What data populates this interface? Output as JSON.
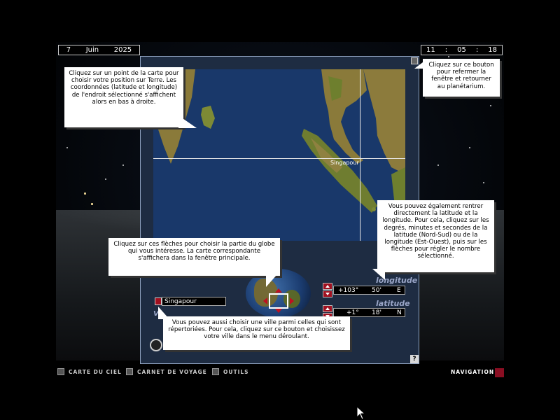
{
  "date": {
    "day": "7",
    "month": "Juin",
    "year": "2025"
  },
  "time": {
    "hours": "11",
    "minutes": "05",
    "seconds": "18"
  },
  "map": {
    "city_label": "Singapour"
  },
  "city_select": {
    "value": "Singapour"
  },
  "longitude": {
    "label": "longitude",
    "degrees": "+103°",
    "minutes": "50'",
    "hemisphere": "E"
  },
  "latitude": {
    "label": "latitude",
    "degrees": "+1°",
    "minutes": "18'",
    "hemisphere": "N"
  },
  "panel": {
    "w_label": "V",
    "help_label": "?"
  },
  "callouts": {
    "map": "Cliquez sur un point de la carte pour choisir votre position sur Terre. Les coordonnées (latitude et longitude) de l'endroit sélectionné s'affichent alors en bas à droite.",
    "close": "Cliquez sur ce bouton pour refermer la fenêtre et retourner au planétarium.",
    "coords": "Vous pouvez également rentrer directement la latitude et la longitude. Pour cela, cliquez sur les degrés, minutes et secondes de la latitude (Nord-Sud) ou de la longitude (Est-Ouest), puis sur les flèches pour régler le nombre sélectionné.",
    "globe": "Cliquez sur ces flèches pour choisir la partie du globe qui vous intéresse. La carte correspondante s'affichera dans la fenêtre principale.",
    "city": "Vous pouvez aussi choisir une ville parmi celles qui sont répertoriées. Pour cela, cliquez sur ce bouton et choisissez votre ville dans le menu déroulant."
  },
  "nav": {
    "items": [
      "CARTE DU CIEL",
      "CARNET DE VOYAGE",
      "OUTILS"
    ],
    "active": "NAVIGATION"
  },
  "colors": {
    "accent": "#8a0e22",
    "map_sea": "#19386a",
    "panel": "#1e2c42"
  }
}
